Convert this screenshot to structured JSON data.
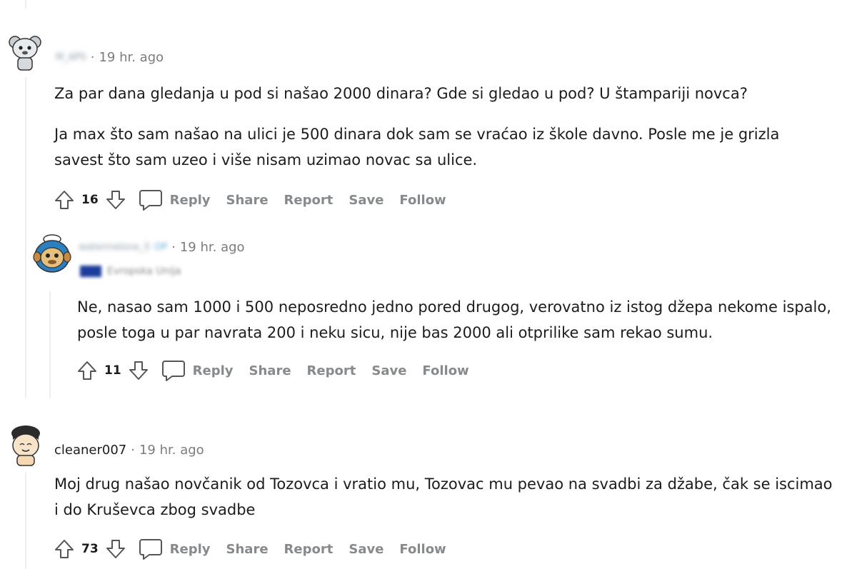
{
  "comments": [
    {
      "username": "M_APS",
      "time": "19 hr. ago",
      "paragraphs": [
        "Za par dana gledanja u pod si našao 2000 dinara? Gde si gledao u pod? U štampariji novca?",
        "Ja max što sam našao na ulici je 500 dinara dok sam se vraćao iz škole davno. Posle me je grizla savest što sam uzeo i više nisam uzimao novac sa ulice."
      ],
      "votes": "16",
      "actions": {
        "reply": "Reply",
        "share": "Share",
        "report": "Report",
        "save": "Save",
        "follow": "Follow"
      }
    },
    {
      "username": "watermelone_S",
      "op_badge": "OP",
      "time": "19 hr. ago",
      "flair": "Evropska Unija",
      "paragraphs": [
        "Ne, nasao sam 1000 i 500 neposredno jedno pored drugog, verovatno iz istog džepa nekome ispalo, posle toga u par navrata 200 i neku sicu, nije bas 2000 ali otprilike sam rekao sumu."
      ],
      "votes": "11",
      "actions": {
        "reply": "Reply",
        "share": "Share",
        "report": "Report",
        "save": "Save",
        "follow": "Follow"
      }
    },
    {
      "username": "cleaner007",
      "time": "19 hr. ago",
      "paragraphs": [
        "Moj drug našao novčanik od Tozovca i vratio mu, Tozovac mu pevao na svadbi za džabe, čak se iscimao i do Kruševca zbog svadbe"
      ],
      "votes": "73",
      "actions": {
        "reply": "Reply",
        "share": "Share",
        "report": "Report",
        "save": "Save",
        "follow": "Follow"
      }
    }
  ],
  "separator": "·",
  "icons": {
    "upvote": "arrow-up-icon",
    "downvote": "arrow-down-icon",
    "comment": "speech-bubble-icon"
  },
  "colors": {
    "text": "#1c1c1c",
    "muted": "#7c7c7c",
    "action": "#878a8c",
    "thread_line": "#edeff1"
  }
}
